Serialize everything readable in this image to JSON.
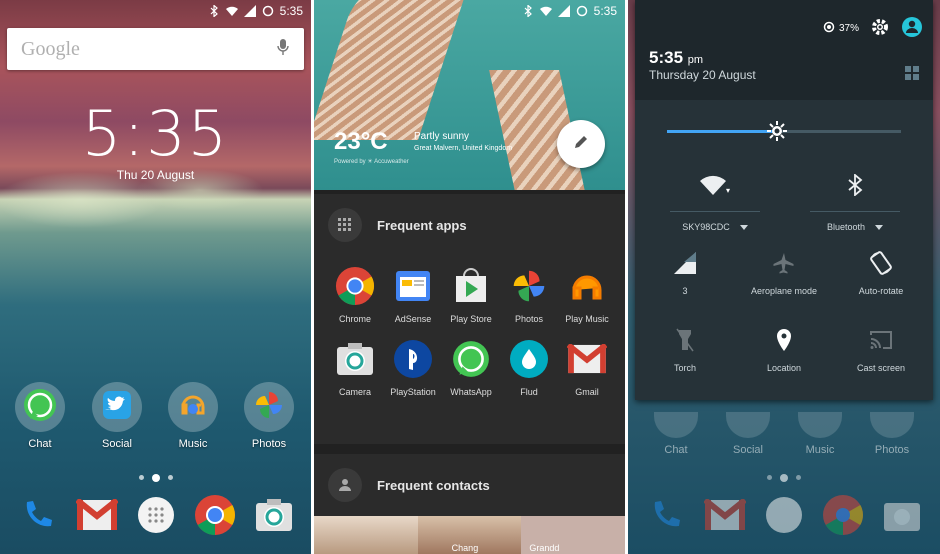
{
  "status": {
    "time": "5:35",
    "battery": "37%"
  },
  "home": {
    "search": {
      "label": "Google"
    },
    "clock": "5:35",
    "date": "Thu 20 August",
    "apps": [
      {
        "label": "Chat",
        "icon": "whatsapp-icon"
      },
      {
        "label": "Social",
        "icon": "twitter-icon"
      },
      {
        "label": "Music",
        "icon": "music-folder-icon"
      },
      {
        "label": "Photos",
        "icon": "photos-icon"
      }
    ],
    "hotseat": [
      "phone-icon",
      "gmail-icon",
      "app-drawer-icon",
      "chrome-icon",
      "camera-icon"
    ]
  },
  "drawer": {
    "weather": {
      "temp": "23°C",
      "condition": "Partly sunny",
      "location": "Great Malvern, United Kingdom",
      "powered": "Powered by ☀ Accuweather"
    },
    "frequent_apps_title": "Frequent apps",
    "apps": [
      {
        "label": "Chrome"
      },
      {
        "label": "AdSense"
      },
      {
        "label": "Play Store"
      },
      {
        "label": "Photos"
      },
      {
        "label": "Play Music"
      },
      {
        "label": "Camera"
      },
      {
        "label": "PlayStation"
      },
      {
        "label": "WhatsApp"
      },
      {
        "label": "Flud"
      },
      {
        "label": "Gmail"
      }
    ],
    "frequent_contacts_title": "Frequent contacts",
    "contacts": [
      "",
      "Chang",
      "Grandd"
    ]
  },
  "quick": {
    "battery": "37%",
    "time": "5:35",
    "ampm": "pm",
    "date": "Thursday 20 August",
    "tiles": [
      {
        "label": "SKY98CDC",
        "icon": "wifi-icon"
      },
      {
        "label": "Bluetooth",
        "icon": "bluetooth-icon"
      },
      {
        "label": "3",
        "icon": "signal-icon"
      },
      {
        "label": "Aeroplane mode",
        "icon": "airplane-icon"
      },
      {
        "label": "Auto-rotate",
        "icon": "rotate-icon"
      },
      {
        "label": "Torch",
        "icon": "torch-icon"
      },
      {
        "label": "Location",
        "icon": "location-icon"
      },
      {
        "label": "Cast screen",
        "icon": "cast-icon"
      }
    ],
    "brightness_fraction": 0.47
  }
}
